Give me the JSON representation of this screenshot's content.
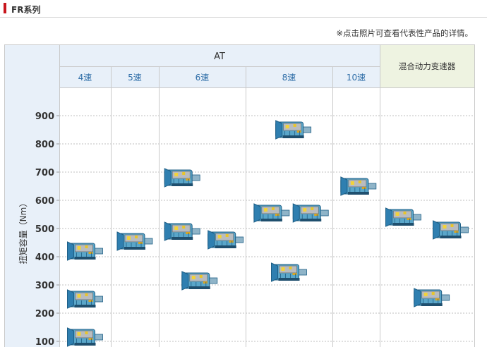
{
  "section": {
    "title": "FR系列"
  },
  "note": "※点击照片可查看代表性产品的详情。",
  "chart_data": {
    "type": "scatter",
    "title": "",
    "ylabel": "扭矩容量（Nm）",
    "yticks": [
      100,
      200,
      300,
      400,
      500,
      600,
      700,
      800,
      900
    ],
    "ylim": [
      75,
      1000
    ],
    "groups": [
      {
        "label": "AT",
        "columns": [
          "4速",
          "5速",
          "6速",
          "8速",
          "10速"
        ]
      },
      {
        "label": "混合动力变速器",
        "columns": []
      }
    ],
    "columns": [
      "4速",
      "5速",
      "6速",
      "8速",
      "10速",
      "混合动力变速器"
    ],
    "points": [
      {
        "column": "4速",
        "y": 420
      },
      {
        "column": "4速",
        "y": 250
      },
      {
        "column": "4速",
        "y": 115
      },
      {
        "column": "5速",
        "y": 455
      },
      {
        "column": "6速",
        "y": 680
      },
      {
        "column": "6速",
        "y": 460
      },
      {
        "column": "6速",
        "y": 490
      },
      {
        "column": "6速",
        "y": 315
      },
      {
        "column": "8速",
        "y": 850
      },
      {
        "column": "8速",
        "y": 555
      },
      {
        "column": "8速",
        "y": 555
      },
      {
        "column": "8速",
        "y": 345
      },
      {
        "column": "10速",
        "y": 650
      },
      {
        "column": "混合动力变速器",
        "y": 540
      },
      {
        "column": "混合动力变速器",
        "y": 495
      },
      {
        "column": "混合动力变速器",
        "y": 255
      }
    ],
    "colors": {
      "header_bg": "#e8f0f9",
      "header_text": "#2f6ea8",
      "hybrid_bg": "#eef3e1",
      "yaxis_bg": "#e8f0f9",
      "grid": "#bfbfbf"
    }
  }
}
